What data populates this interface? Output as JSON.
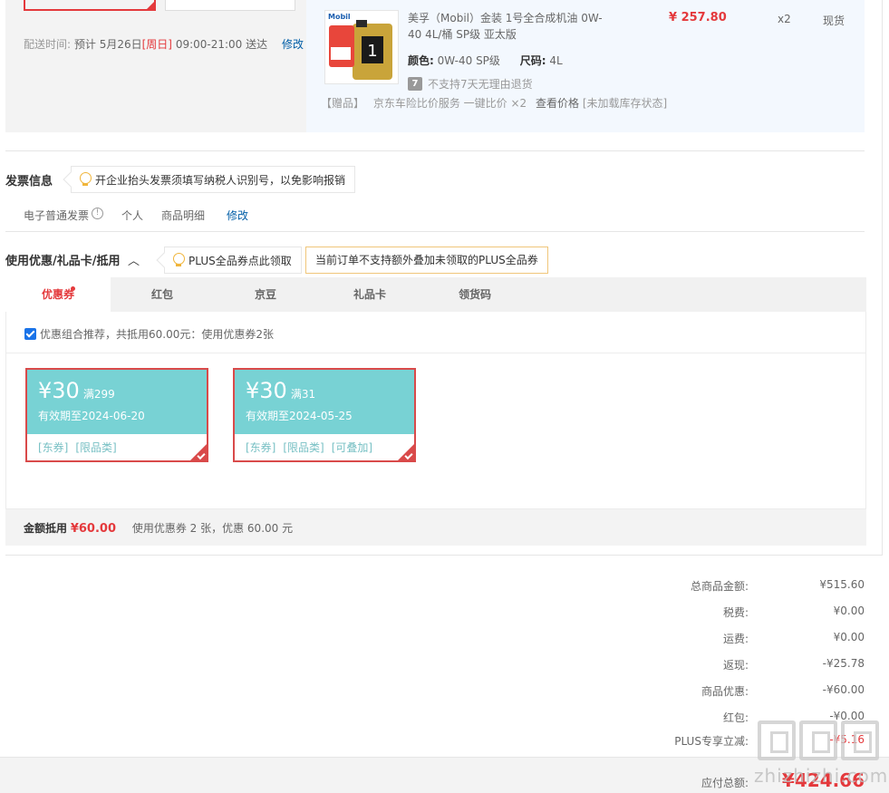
{
  "delivery": {
    "label": "配送时间:",
    "value": "预计 5月26日",
    "day": "[周日]",
    "window": "09:00-21:00 送达",
    "modify": "修改"
  },
  "product": {
    "title": "美孚（Mobil）金装 1号全合成机油 0W-40 4L/桶 SP级 亚太版",
    "price": "¥ 257.80",
    "qty": "x2",
    "stock": "现货",
    "color_label": "颜色:",
    "color_value": "0W-40 SP级",
    "size_label": "尺码:",
    "size_value": "4L",
    "no_return_icon": "7",
    "no_return": "不支持7天无理由退货",
    "gift_tag": "【赠品】",
    "gift_text": "京东车险比价服务 一键比价 ×2",
    "gift_link": "查看价格",
    "gift_status": "[未加载库存状态]",
    "image_brand": "Mobil",
    "image_badge": "1"
  },
  "invoice": {
    "title": "发票信息",
    "tip": "开企业抬头发票须填写纳税人识别号，以免影响报销",
    "type": "电子普通发票",
    "info_icon": "!",
    "holder": "个人",
    "content": "商品明细",
    "modify": "修改"
  },
  "coupons_section": {
    "title": "使用优惠/礼品卡/抵用",
    "caret": "︿",
    "plus_tip": "PLUS全品券点此领取",
    "warning": "当前订单不支持额外叠加未领取的PLUS全品券",
    "tabs": [
      "优惠券",
      "红包",
      "京豆",
      "礼品卡",
      "领货码"
    ],
    "combo_text": "优惠组合推荐，共抵用60.00元：使用优惠券2张",
    "coupons": [
      {
        "amount": "¥30",
        "condition": "满299",
        "expiry": "有效期至2024-06-20",
        "tags": [
          "[东券]",
          "[限品类]"
        ]
      },
      {
        "amount": "¥30",
        "condition": "满31",
        "expiry": "有效期至2024-05-25",
        "tags": [
          "[东券]",
          "[限品类]",
          "[可叠加]"
        ]
      }
    ],
    "summary_label": "金额抵用",
    "summary_amount": "¥60.00",
    "summary_text": "使用优惠券 2 张，优惠 60.00 元"
  },
  "totals": {
    "rows": [
      {
        "label": "总商品金额:",
        "value": "¥515.60"
      },
      {
        "label": "税费:",
        "value": "¥0.00"
      },
      {
        "label": "运费:",
        "value": "¥0.00"
      },
      {
        "label": "返现:",
        "value": "-¥25.78"
      },
      {
        "label": "商品优惠:",
        "value": "-¥60.00"
      },
      {
        "label": "红包:",
        "value": "-¥0.00"
      },
      {
        "label": "PLUS专享立减:",
        "value": "-¥5.16"
      }
    ],
    "pay_label": "应付总额:",
    "pay_value": "¥424.66"
  },
  "watermark": {
    "text": "zhizhizhi.com"
  },
  "colors": {
    "accent_red": "#e4393c",
    "link_blue": "#005ea7",
    "coupon_teal": "#78d2d4"
  }
}
